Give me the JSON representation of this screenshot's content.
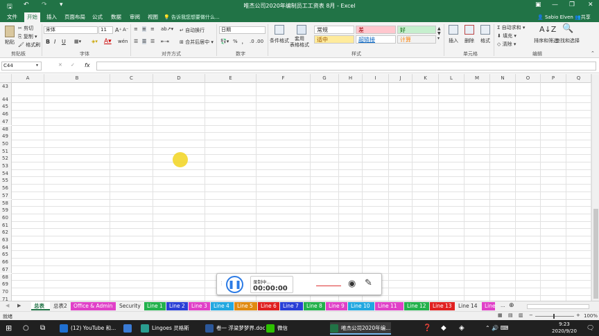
{
  "titlebar": {
    "title": "唯杰公司2020年编制员工工资表 8月 - Excel",
    "save_icon": "save-icon",
    "undo": "↶",
    "redo": "↷",
    "customize": "▾",
    "minimize": "—",
    "restore": "❐",
    "close": "✕",
    "ribbon_display": "▣"
  },
  "tabs": [
    "文件",
    "开始",
    "插入",
    "页面布局",
    "公式",
    "数据",
    "审阅",
    "视图"
  ],
  "active_tab": "开始",
  "tell_me": "告诉我您想要做什么...",
  "user": {
    "name": "Sabio Elven",
    "share": "共享"
  },
  "ribbon": {
    "clipboard": {
      "paste": "粘贴",
      "cut": "剪切",
      "copy": "复制 ▾",
      "format_painter": "格式刷",
      "label": "剪贴板"
    },
    "font": {
      "name": "宋体",
      "size": "11",
      "grow": "A⁺",
      "shrink": "A⁻",
      "bold": "B",
      "italic": "I",
      "underline": "U",
      "label": "字体",
      "wen": "wén"
    },
    "alignment": {
      "wrap": "自动换行",
      "merge": "合并后居中",
      "label": "对齐方式"
    },
    "number": {
      "format": "日期",
      "percent": "%",
      "comma": "，",
      "label": "数字"
    },
    "styles": {
      "conditional": "条件格式",
      "table": "套用\n表格格式",
      "label": "样式",
      "items": [
        {
          "text": "常规",
          "bg": "#ffffff",
          "color": "#222222"
        },
        {
          "text": "差",
          "bg": "#ffc7ce",
          "color": "#9c0006"
        },
        {
          "text": "好",
          "bg": "#c6efce",
          "color": "#006100"
        },
        {
          "text": "适中",
          "bg": "#ffeb9c",
          "color": "#9c5700"
        },
        {
          "text": "超链接",
          "bg": "#ffffff",
          "color": "#0563c1"
        },
        {
          "text": "计算",
          "bg": "#f2f2f2",
          "color": "#fa7d00"
        }
      ]
    },
    "cells": {
      "insert": "插入",
      "delete": "删除",
      "format": "格式",
      "label": "单元格"
    },
    "editing": {
      "autosum": "自动求和",
      "fill": "填充",
      "clear": "清除",
      "sort": "排序和筛选",
      "find": "查找和选择",
      "label": "编辑"
    }
  },
  "formula_bar": {
    "name_box": "C44",
    "cancel": "✕",
    "enter": "✓",
    "fx": "fx",
    "value": ""
  },
  "grid": {
    "columns": [
      "A",
      "B",
      "C",
      "D",
      "E",
      "F",
      "G",
      "H",
      "I",
      "J",
      "K",
      "L",
      "M",
      "N",
      "O",
      "P",
      "Q"
    ],
    "rows": [
      "43",
      "44",
      "45",
      "46",
      "47",
      "48",
      "49",
      "50",
      "51",
      "52",
      "53",
      "54",
      "55",
      "56",
      "57",
      "58",
      "59",
      "60",
      "61",
      "62",
      "63",
      "64",
      "65",
      "66",
      "67",
      "68",
      "69",
      "70",
      "71"
    ]
  },
  "sheet_tabs": [
    {
      "name": "总表",
      "bg": "#ffffff",
      "color": "#217346",
      "active": true
    },
    {
      "name": "总表2",
      "bg": "#f0f0f0",
      "color": "#333333"
    },
    {
      "name": "Office & Admin",
      "bg": "#e040c8",
      "color": "#ffffff"
    },
    {
      "name": "Security",
      "bg": "#f0f0f0",
      "color": "#333333"
    },
    {
      "name": "Line 1",
      "bg": "#22b14c",
      "color": "#ffffff"
    },
    {
      "name": "Line 2",
      "bg": "#2a3fd6",
      "color": "#ffffff"
    },
    {
      "name": "Line 3",
      "bg": "#e040c8",
      "color": "#ffffff"
    },
    {
      "name": "Line 4",
      "bg": "#22a8e0",
      "color": "#ffffff"
    },
    {
      "name": "Line 5",
      "bg": "#e08a10",
      "color": "#ffffff"
    },
    {
      "name": "Line 6",
      "bg": "#e02020",
      "color": "#ffffff"
    },
    {
      "name": "Line 7",
      "bg": "#2a3fd6",
      "color": "#ffffff"
    },
    {
      "name": "Line 8",
      "bg": "#22b14c",
      "color": "#ffffff"
    },
    {
      "name": "Line 9",
      "bg": "#e040c8",
      "color": "#ffffff"
    },
    {
      "name": "Line 10",
      "bg": "#22a8e0",
      "color": "#ffffff"
    },
    {
      "name": "Line 11",
      "bg": "#e040c8",
      "color": "#ffffff"
    },
    {
      "name": "Line 12",
      "bg": "#22b14c",
      "color": "#ffffff"
    },
    {
      "name": "Line 13",
      "bg": "#e02020",
      "color": "#ffffff"
    },
    {
      "name": "Line 14",
      "bg": "#f0f0f0",
      "color": "#333333"
    },
    {
      "name": "Line",
      "bg": "#e040c8",
      "color": "#ffffff"
    }
  ],
  "sheet_more": "...",
  "status": {
    "mode": "就绪",
    "zoom": "100%",
    "zoom_minus": "−",
    "zoom_plus": "+"
  },
  "recorder": {
    "status": "录制中...",
    "time": "00:00:00"
  },
  "taskbar": {
    "items": [
      {
        "label": "(12) YouTube 和...",
        "color": "#1f6fd1"
      },
      {
        "label": "",
        "color": "#3a7bd5"
      },
      {
        "label": "Lingoes 灵格斯",
        "color": "#2a9d8f"
      },
      {
        "label": "卷一 浮梁梦梦界.doc...",
        "color": "#2b579a"
      },
      {
        "label": "微信",
        "color": "#2dc100"
      },
      {
        "label": "唯杰公司2020年编...",
        "color": "#217346"
      }
    ],
    "time": "9:23",
    "date": "2020/9/20"
  }
}
